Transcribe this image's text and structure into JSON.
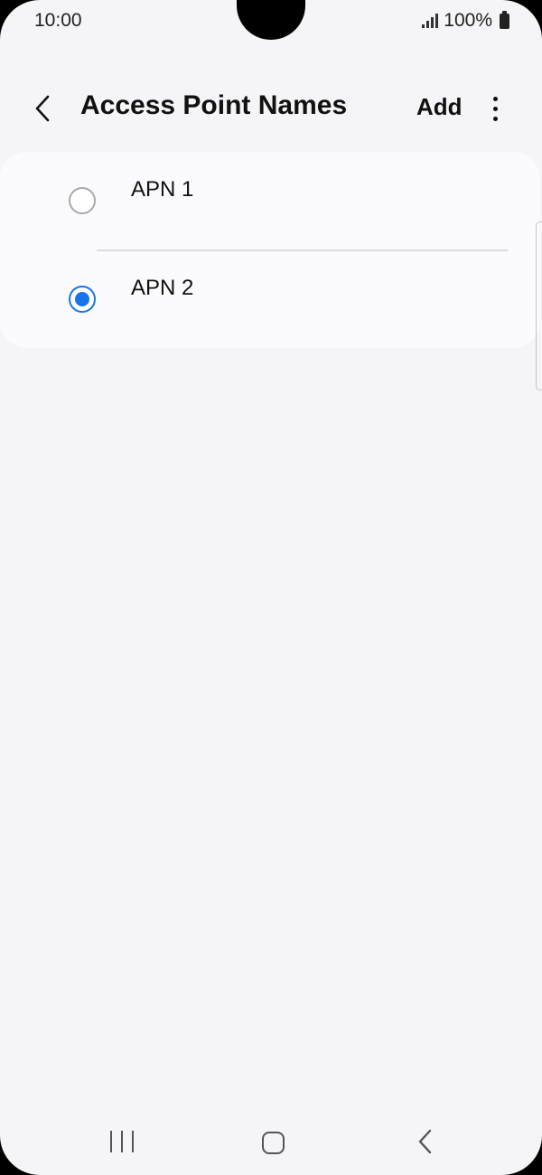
{
  "status_bar": {
    "time": "10:00",
    "battery_text": "100%",
    "icons": [
      "signal-icon",
      "battery-icon"
    ]
  },
  "app_bar": {
    "title": "Access Point Names",
    "add_label": "Add",
    "icons": [
      "back-arrow-icon",
      "more-options-icon"
    ]
  },
  "apn_list": {
    "items": [
      {
        "label": "APN 1",
        "selected": false
      },
      {
        "label": "APN 2",
        "selected": true
      }
    ]
  },
  "colors": {
    "accent": "#1a73e8",
    "background": "#f5f5f7",
    "card": "#fbfbfd"
  },
  "nav_bar": {
    "icons": [
      "recent-apps-icon",
      "home-icon",
      "back-icon"
    ]
  }
}
